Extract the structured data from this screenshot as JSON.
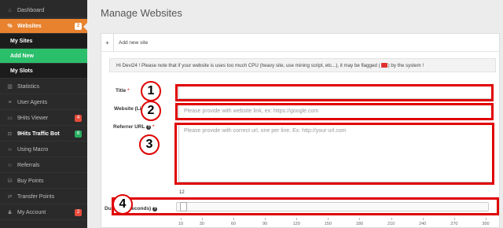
{
  "sidebar": {
    "items": [
      {
        "label": "Dashboard",
        "icon": "home-icon",
        "glyph": "⌂"
      },
      {
        "label": "Websites",
        "icon": "link-icon",
        "glyph": "%",
        "badge": "2"
      },
      {
        "label": "My Sites"
      },
      {
        "label": "Add New"
      },
      {
        "label": "My Slots"
      },
      {
        "label": "Statistics",
        "icon": "bar-chart-icon",
        "glyph": "▥"
      },
      {
        "label": "User Agents",
        "icon": "list-icon",
        "glyph": "≡"
      },
      {
        "label": "9Hits Viewer",
        "icon": "monitor-icon",
        "glyph": "▭",
        "badge": "4"
      },
      {
        "label": "9Hits Traffic Bot",
        "icon": "robot-icon",
        "glyph": "◘",
        "badge": "8"
      },
      {
        "label": "Using Macro",
        "icon": "code-icon",
        "glyph": "‹›"
      },
      {
        "label": "Referrals",
        "icon": "users-icon",
        "glyph": "☺"
      },
      {
        "label": "Buy Points",
        "icon": "cart-icon",
        "glyph": "⛁"
      },
      {
        "label": "Transfer Points",
        "icon": "transfer-icon",
        "glyph": "⇄"
      },
      {
        "label": "My Account",
        "icon": "user-icon",
        "glyph": "♟",
        "badge": "2"
      }
    ]
  },
  "page": {
    "title": "Manage Websites"
  },
  "card": {
    "tab_plus": "+",
    "tab_label": "Add new site",
    "notice_before": "Hi Devi24 ! Please note that if your website is uses too much CPU (heavy site, use mining script, etc...), it may be flagged (",
    "notice_after": ") by the system !"
  },
  "form": {
    "title_label": "Title",
    "website_label": "Website (Link)",
    "website_placeholder": "Please provide with website link, ex: https://google.com",
    "referrer_label": "Referrer URL",
    "referrer_placeholder": "Please provide with correct url, one per line. Ex: http://your-url.com",
    "duration_label": "Duration (seconds)",
    "required_mark": "*",
    "help_glyph": "?",
    "slider_value": "12",
    "slider_min": 10,
    "slider_max": 300,
    "slider_ticks": [
      "10",
      "30",
      "60",
      "90",
      "120",
      "150",
      "180",
      "210",
      "240",
      "270",
      "300"
    ]
  },
  "annotations": [
    "1",
    "2",
    "3",
    "4"
  ],
  "colors": {
    "accent": "#e8822e",
    "green": "#2cbf6b",
    "highlight": "#e00000",
    "sidebar_bg": "#2a2a2a"
  }
}
